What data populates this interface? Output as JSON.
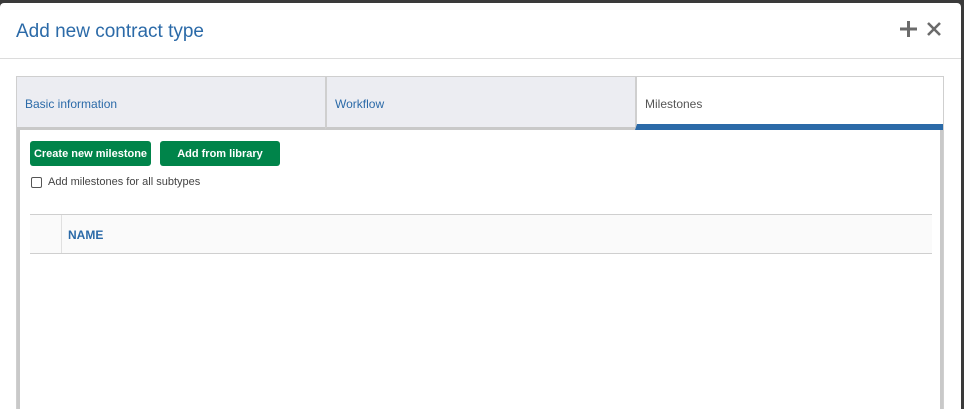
{
  "dialog": {
    "title": "Add new contract type",
    "header_icons": [
      "plus-icon",
      "close-icon"
    ]
  },
  "tabs": [
    {
      "label": "Basic information",
      "active": false
    },
    {
      "label": "Workflow",
      "active": false
    },
    {
      "label": "Milestones",
      "active": true
    }
  ],
  "milestones": {
    "create_button": "Create new milestone",
    "library_button": "Add from library",
    "checkbox_label": "Add milestones for all subtypes",
    "checkbox_checked": false,
    "columns": [
      "NAME"
    ],
    "rows": []
  },
  "colors": {
    "accent": "#2b6aa8",
    "primary_button": "#00844a"
  }
}
